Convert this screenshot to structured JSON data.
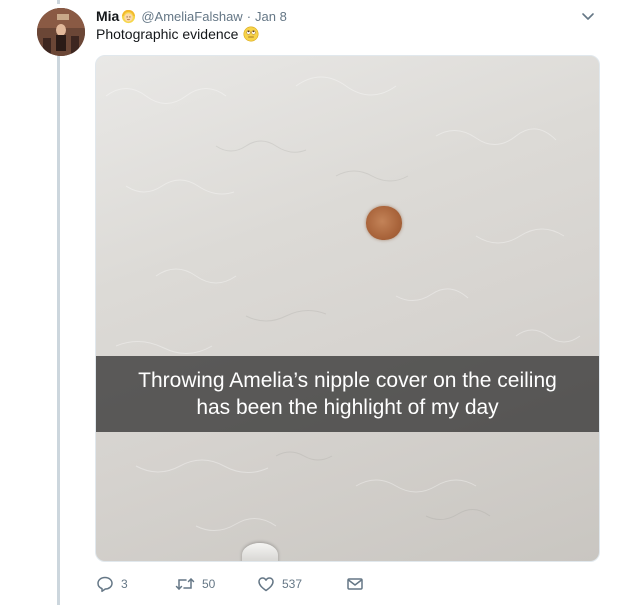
{
  "tweet": {
    "author_name": "Mia",
    "author_handle": "@AmeliaFalshaw",
    "separator": "·",
    "date": "Jan 8",
    "text": "Photographic evidence",
    "media": {
      "caption_line1": "Throwing Amelia’s nipple cover on the ceiling",
      "caption_line2": "has been the highlight of my day"
    },
    "actions": {
      "reply_count": "3",
      "retweet_count": "50",
      "like_count": "537"
    }
  },
  "icons": {
    "author_emoji": "blonde-person-emoji",
    "text_emoji": "face-with-rolling-eyes-emoji",
    "caret": "chevron-down-icon",
    "reply": "reply-icon",
    "retweet": "retweet-icon",
    "like": "heart-icon",
    "dm": "envelope-icon"
  },
  "colors": {
    "secondary_text": "#657786",
    "thread_line": "#ccd6dd",
    "caption_band": "#282828"
  }
}
